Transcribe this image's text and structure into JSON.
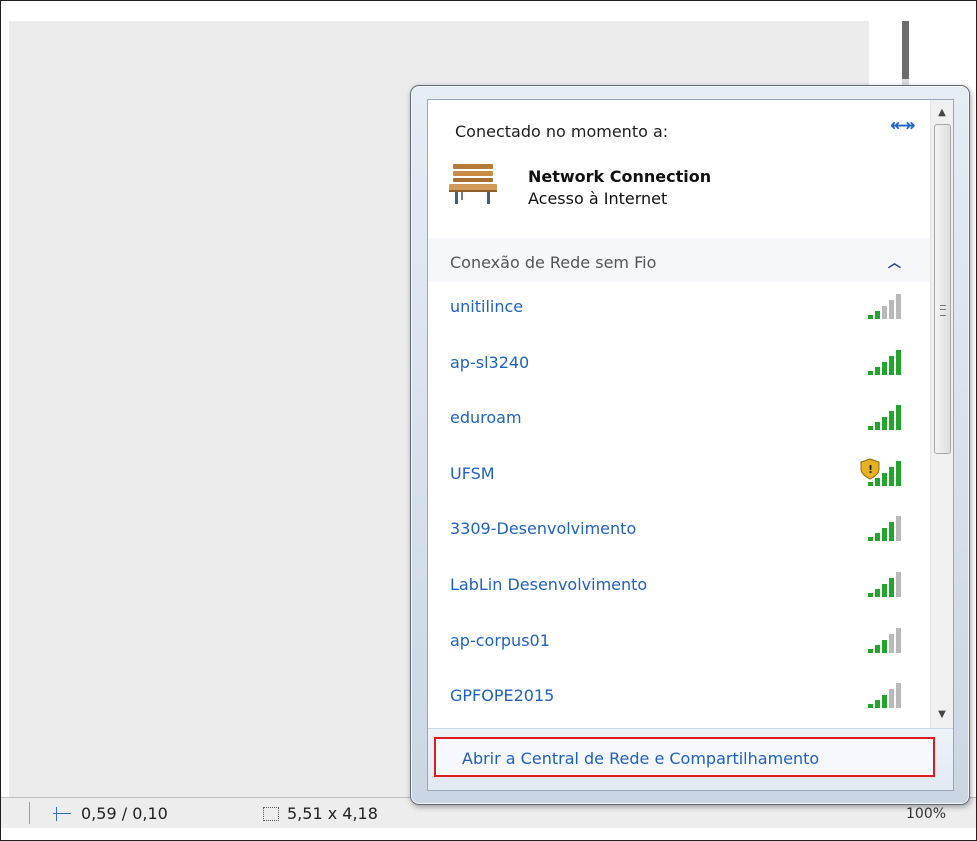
{
  "statusbar": {
    "position_value": "0,59 / 0,10",
    "size_value": "5,51 x 4,18",
    "zoom_partial": "100%"
  },
  "popup": {
    "connected_label": "Conectado no momento a:",
    "connection_name": "Network Connection",
    "connection_status": "Acesso à Internet",
    "section_title": "Conexão de Rede sem Fio",
    "networks": [
      {
        "name": "unitilince",
        "signal_level": 2,
        "secured": false
      },
      {
        "name": "ap-sl3240",
        "signal_level": 5,
        "secured": false
      },
      {
        "name": "eduroam",
        "signal_level": 5,
        "secured": false
      },
      {
        "name": "UFSM",
        "signal_level": 5,
        "secured": true
      },
      {
        "name": "3309-Desenvolvimento",
        "signal_level": 4,
        "secured": false
      },
      {
        "name": "LabLin Desenvolvimento",
        "signal_level": 4,
        "secured": false
      },
      {
        "name": "ap-corpus01",
        "signal_level": 3,
        "secured": false
      },
      {
        "name": "GPFOPE2015",
        "signal_level": 3,
        "secured": false
      }
    ],
    "open_center_label": "Abrir a Central de Rede e Compartilhamento"
  },
  "colors": {
    "link": "#1f62bf",
    "signal_active": "#21a52b",
    "signal_inactive": "#b9b9b9",
    "highlight_border": "#e01b1b"
  },
  "icons": {
    "refresh": "refresh-icon",
    "network": "bench-network-icon",
    "collapse": "chevron-up-icon",
    "security_warning": "shield-warning-icon"
  }
}
